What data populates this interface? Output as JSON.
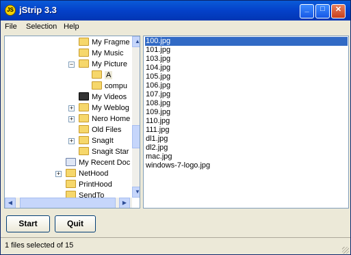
{
  "window": {
    "title": "jStrip 3.3",
    "icon_label": "JS"
  },
  "title_buttons": {
    "minimize": "_",
    "maximize": "□",
    "close": "✕"
  },
  "menu": [
    "File",
    "Selection",
    "Help"
  ],
  "tree": {
    "items": [
      {
        "label": "My Fragme",
        "icon": "folder-icon"
      },
      {
        "label": "My Music",
        "icon": "music-folder-icon"
      },
      {
        "label": "My Picture",
        "icon": "pictures-folder-icon",
        "expander": "−"
      },
      {
        "label": "A",
        "icon": "open-folder-icon",
        "selected": true
      },
      {
        "label": "compu",
        "icon": "folder-icon"
      },
      {
        "label": "My Videos",
        "icon": "video-folder-icon"
      },
      {
        "label": "My Weblog",
        "icon": "folder-icon",
        "expander": "+"
      },
      {
        "label": "Nero Home",
        "icon": "folder-icon",
        "expander": "+"
      },
      {
        "label": "Old Files",
        "icon": "folder-icon"
      },
      {
        "label": "SnagIt",
        "icon": "folder-icon",
        "expander": "+"
      },
      {
        "label": "Snagit Star",
        "icon": "folder-icon"
      },
      {
        "label": "My Recent Doc",
        "icon": "recent-docs-icon"
      },
      {
        "label": "NetHood",
        "icon": "folder-icon",
        "expander": "+"
      },
      {
        "label": "PrintHood",
        "icon": "folder-icon"
      },
      {
        "label": "SendTo",
        "icon": "folder-icon"
      }
    ]
  },
  "files": {
    "items": [
      "100.jpg",
      "101.jpg",
      "103.jpg",
      "104.jpg",
      "105.jpg",
      "106.jpg",
      "107.jpg",
      "108.jpg",
      "109.jpg",
      "110.jpg",
      "111.jpg",
      "dl1.jpg",
      "dl2.jpg",
      "mac.jpg",
      "windows-7-logo.jpg"
    ],
    "selected_index": 0
  },
  "buttons": {
    "start": "Start",
    "quit": "Quit"
  },
  "status": {
    "text": "1 files selected of 15"
  },
  "colors": {
    "titlebar": "#0a5bd8",
    "selection": "#316ac5",
    "window_bg": "#ece9d8",
    "close_button": "#c8401c"
  }
}
